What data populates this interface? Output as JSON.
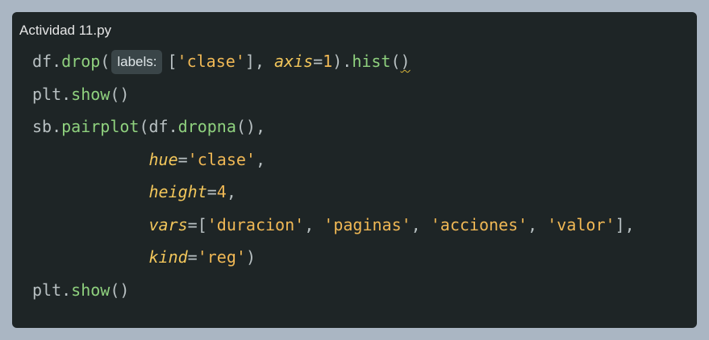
{
  "editor": {
    "filename": "Actividad 11.py",
    "inlay_hint": "labels:",
    "lines": [
      [
        {
          "t": "plain",
          "v": "df."
        },
        {
          "t": "fn",
          "v": "drop"
        },
        {
          "t": "plain",
          "v": "("
        },
        {
          "t": "hint",
          "v": "labels:"
        },
        {
          "t": "plain",
          "v": "["
        },
        {
          "t": "str",
          "v": "'clase'"
        },
        {
          "t": "plain",
          "v": "], "
        },
        {
          "t": "kw",
          "v": "axis"
        },
        {
          "t": "plain",
          "v": "="
        },
        {
          "t": "num",
          "v": "1"
        },
        {
          "t": "plain",
          "v": ")."
        },
        {
          "t": "fn",
          "v": "hist"
        },
        {
          "t": "plain",
          "v": "("
        },
        {
          "t": "squiggle",
          "v": ")"
        }
      ],
      [
        {
          "t": "plain",
          "v": "plt."
        },
        {
          "t": "fn",
          "v": "show"
        },
        {
          "t": "plain",
          "v": "()"
        }
      ],
      [
        {
          "t": "plain",
          "v": "sb."
        },
        {
          "t": "fn",
          "v": "pairplot"
        },
        {
          "t": "plain",
          "v": "(df."
        },
        {
          "t": "fn",
          "v": "dropna"
        },
        {
          "t": "plain",
          "v": "(),"
        }
      ],
      [
        {
          "t": "plain",
          "v": "            "
        },
        {
          "t": "kw",
          "v": "hue"
        },
        {
          "t": "plain",
          "v": "="
        },
        {
          "t": "str",
          "v": "'clase'"
        },
        {
          "t": "plain",
          "v": ","
        }
      ],
      [
        {
          "t": "plain",
          "v": "            "
        },
        {
          "t": "kw",
          "v": "height"
        },
        {
          "t": "plain",
          "v": "="
        },
        {
          "t": "num",
          "v": "4"
        },
        {
          "t": "plain",
          "v": ","
        }
      ],
      [
        {
          "t": "plain",
          "v": "            "
        },
        {
          "t": "kw",
          "v": "vars"
        },
        {
          "t": "plain",
          "v": "=["
        },
        {
          "t": "str",
          "v": "'duracion'"
        },
        {
          "t": "plain",
          "v": ", "
        },
        {
          "t": "str",
          "v": "'paginas'"
        },
        {
          "t": "plain",
          "v": ", "
        },
        {
          "t": "str",
          "v": "'acciones'"
        },
        {
          "t": "plain",
          "v": ", "
        },
        {
          "t": "str",
          "v": "'valor'"
        },
        {
          "t": "plain",
          "v": "],"
        }
      ],
      [
        {
          "t": "plain",
          "v": "            "
        },
        {
          "t": "kw",
          "v": "kind"
        },
        {
          "t": "plain",
          "v": "="
        },
        {
          "t": "str",
          "v": "'reg'"
        },
        {
          "t": "plain",
          "v": ")"
        }
      ],
      [
        {
          "t": "plain",
          "v": "plt."
        },
        {
          "t": "fn",
          "v": "show"
        },
        {
          "t": "plain",
          "v": "()"
        }
      ]
    ]
  },
  "colors": {
    "background": "#aab6c3",
    "editor_bg": "#1e2526",
    "function": "#8fd17e",
    "string": "#f0b855",
    "keyword_arg": "#f2c65b",
    "plain": "#b8c0c2"
  }
}
